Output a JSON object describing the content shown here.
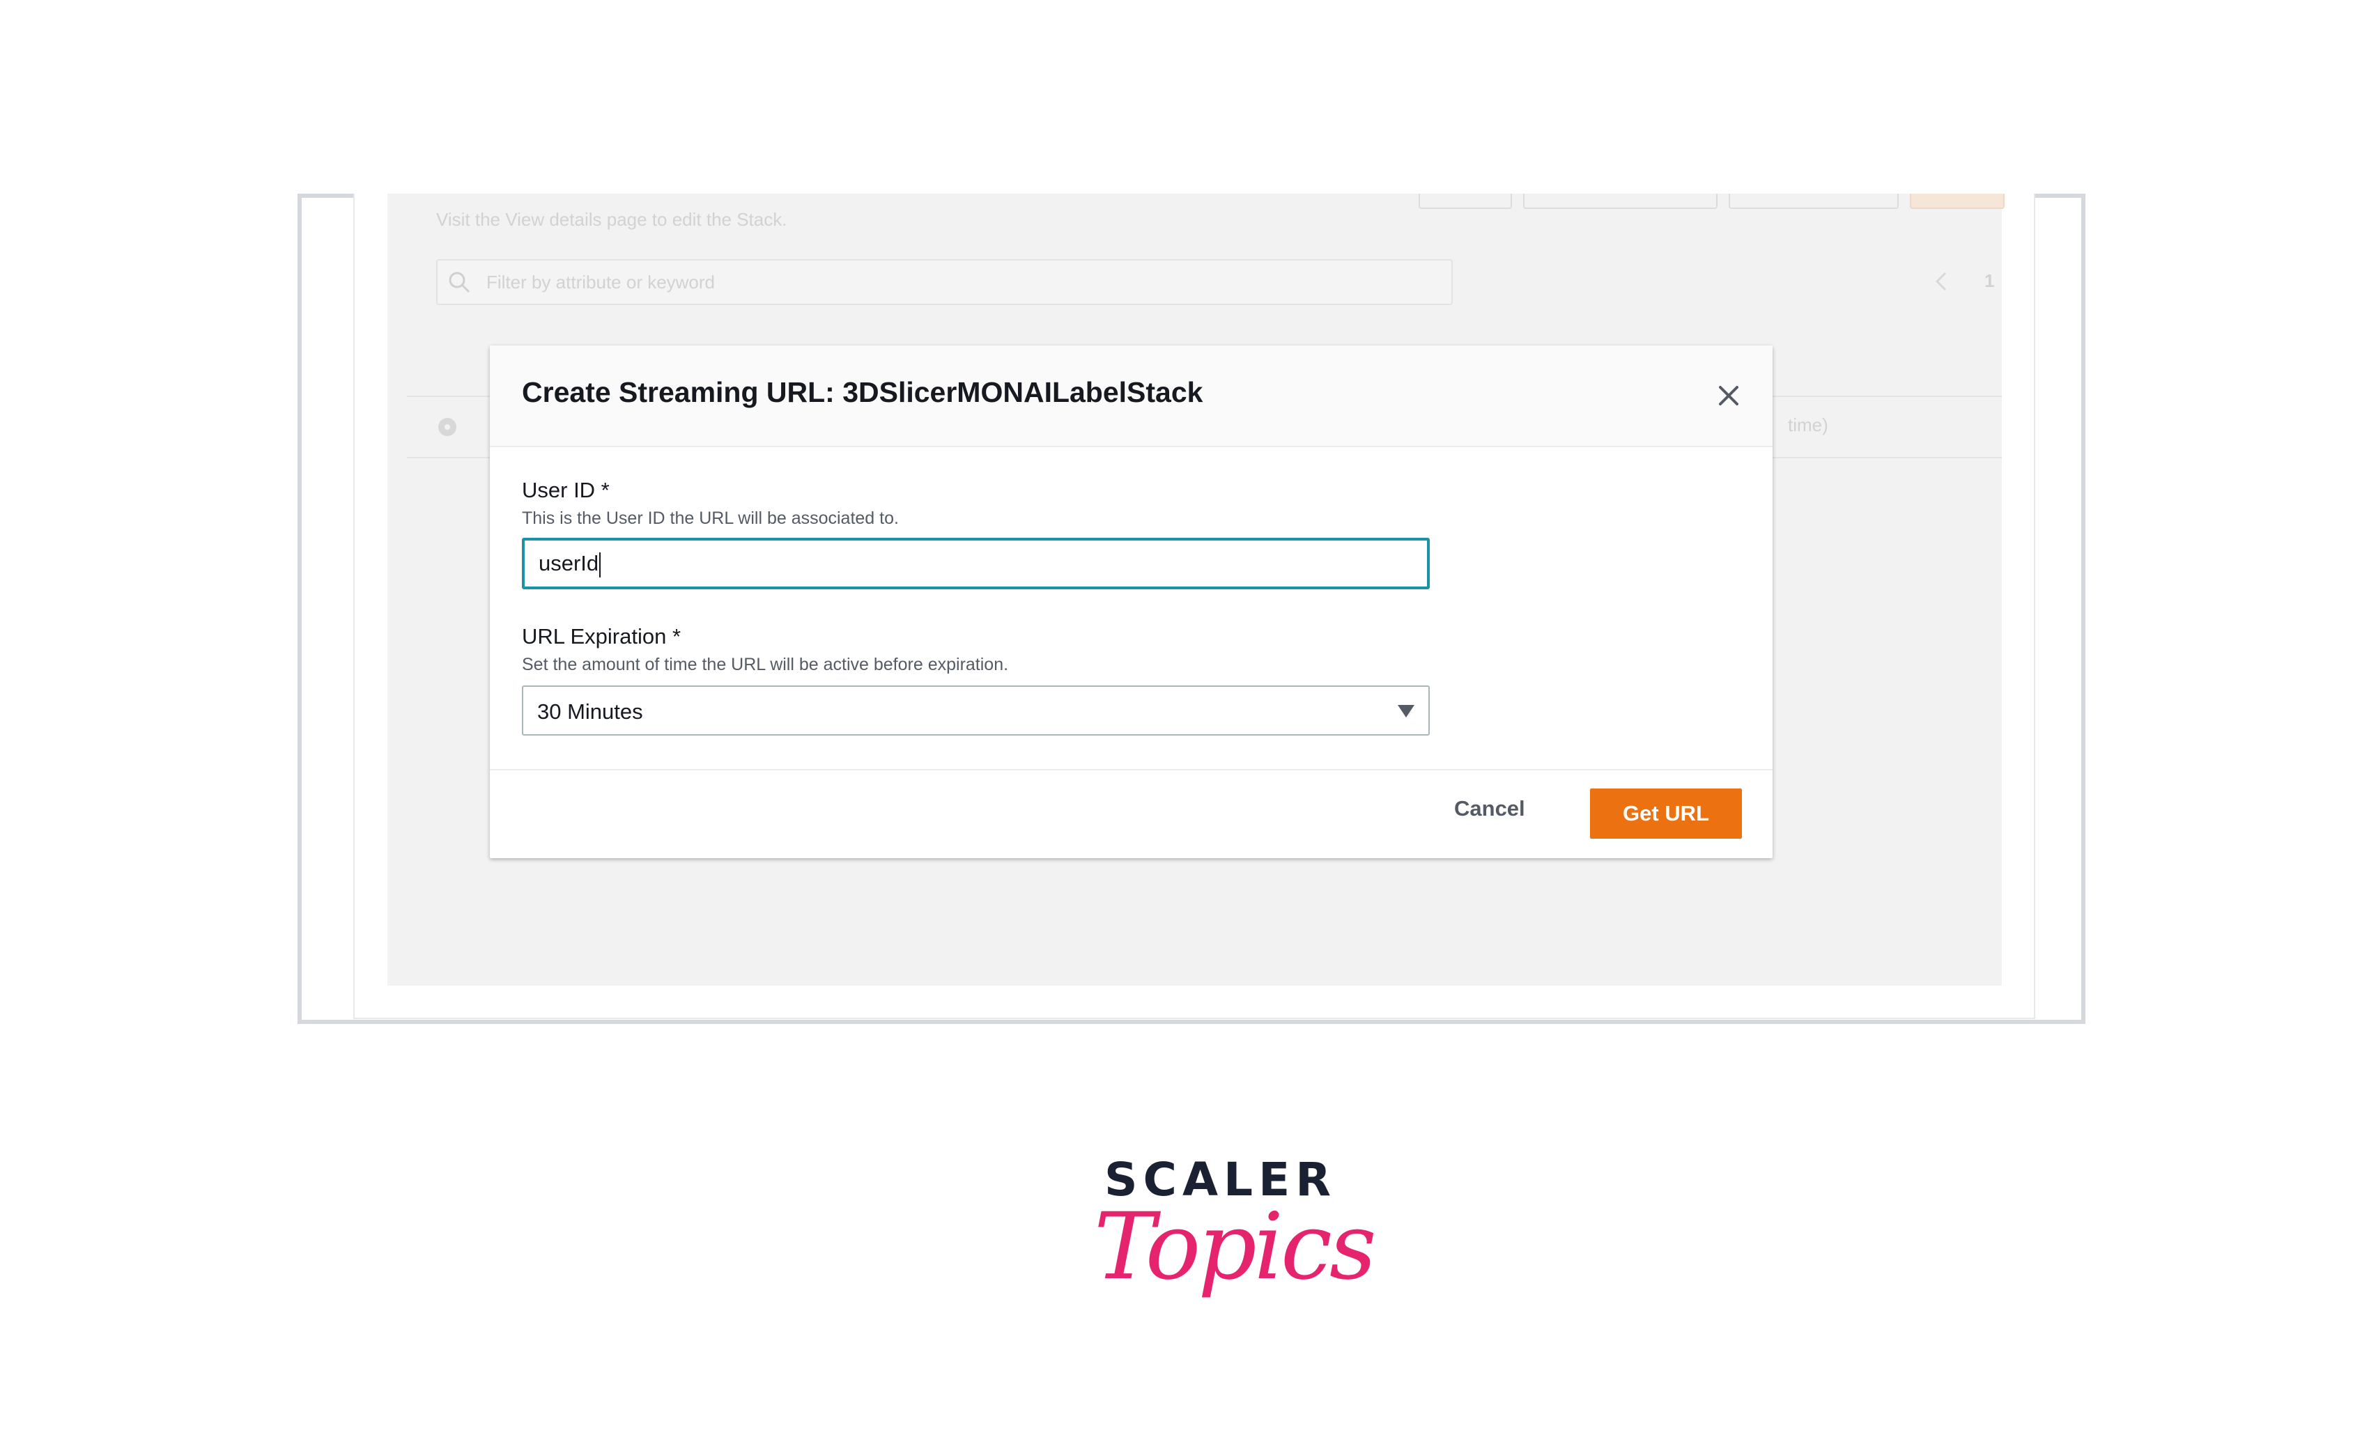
{
  "background_console": {
    "hint_text": "Visit the View details page to edit the Stack.",
    "search_placeholder": "Filter by attribute or keyword",
    "page_number": "1",
    "row_text_fragment": "time)"
  },
  "modal": {
    "title": "Create Streaming URL: 3DSlicerMONAILabelStack",
    "user_id": {
      "label": "User ID *",
      "description": "This is the User ID the URL will be associated to.",
      "value": "userId"
    },
    "url_expiration": {
      "label": "URL Expiration *",
      "description": "Set the amount of time the URL will be active before expiration.",
      "selected": "30 Minutes"
    },
    "cancel_label": "Cancel",
    "primary_label": "Get URL"
  },
  "logo": {
    "top": "SCALER",
    "bottom": "Topics"
  },
  "colors": {
    "primary_button": "#ec7211",
    "input_focus_border": "#1a93a6",
    "logo_dark": "#1a2133",
    "logo_pink": "#e6246d"
  }
}
